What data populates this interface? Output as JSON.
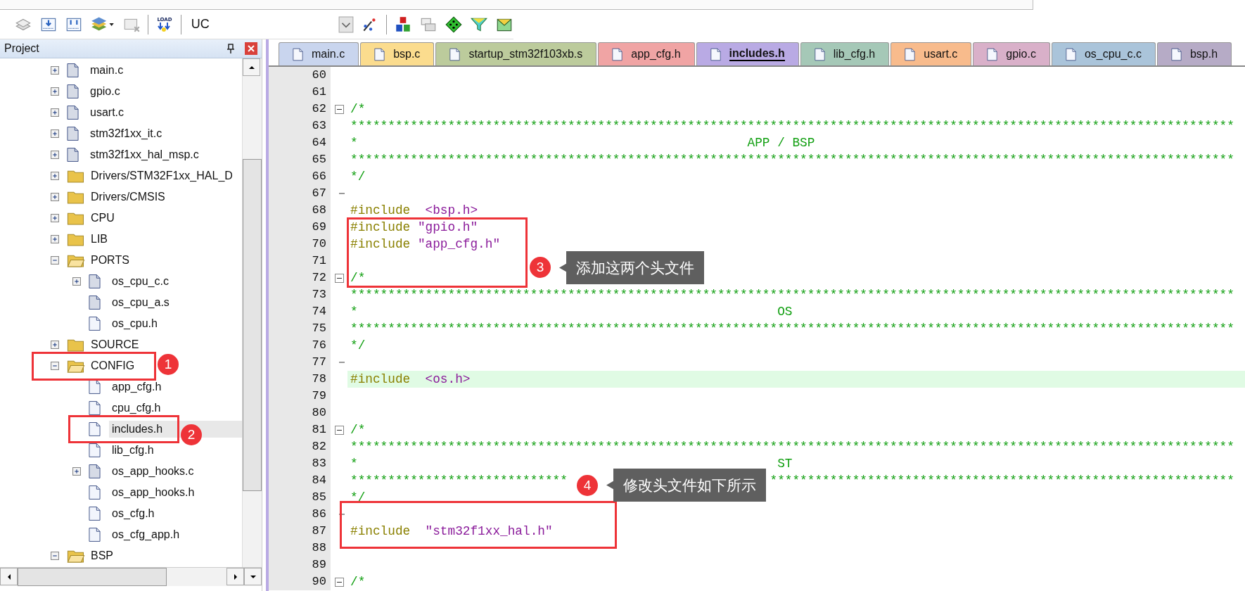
{
  "toolbar": {
    "load_label": "LOAD",
    "target": "UC"
  },
  "project": {
    "title": "Project",
    "tree": [
      {
        "children": [
          {
            "label": "main.c",
            "kind": "source",
            "expanded": false,
            "selected": false
          },
          {
            "label": "gpio.c",
            "kind": "source",
            "expanded": false,
            "selected": false
          },
          {
            "label": "usart.c",
            "kind": "source",
            "expanded": false,
            "selected": false
          },
          {
            "label": "stm32f1xx_it.c",
            "kind": "source",
            "expanded": false,
            "selected": false
          },
          {
            "label": "stm32f1xx_hal_msp.c",
            "kind": "source",
            "expanded": false,
            "selected": false
          }
        ]
      },
      {
        "label": "Drivers/STM32F1xx_HAL_D",
        "kind": "folder",
        "expanded": false,
        "selected": false
      },
      {
        "label": "Drivers/CMSIS",
        "kind": "folder",
        "expanded": false,
        "selected": false
      },
      {
        "label": "CPU",
        "kind": "folder",
        "expanded": false,
        "selected": false
      },
      {
        "label": "LIB",
        "kind": "folder",
        "expanded": false,
        "selected": false
      },
      {
        "label": "PORTS",
        "kind": "folder",
        "expanded": true,
        "selected": false,
        "children": [
          {
            "label": "os_cpu_c.c",
            "kind": "source",
            "expanded": false,
            "selected": false
          },
          {
            "label": "os_cpu_a.s",
            "kind": "source",
            "selected": false
          },
          {
            "label": "os_cpu.h",
            "kind": "header",
            "selected": false
          }
        ]
      },
      {
        "label": "SOURCE",
        "kind": "folder",
        "expanded": false,
        "selected": false
      },
      {
        "label": "CONFIG",
        "kind": "folder",
        "expanded": true,
        "selected": false,
        "children": [
          {
            "label": "app_cfg.h",
            "kind": "header",
            "selected": false
          },
          {
            "label": "cpu_cfg.h",
            "kind": "header",
            "selected": false
          },
          {
            "label": "includes.h",
            "kind": "header",
            "selected": true
          },
          {
            "label": "lib_cfg.h",
            "kind": "header",
            "selected": false
          },
          {
            "label": "os_app_hooks.c",
            "kind": "source",
            "expanded": false,
            "selected": false
          },
          {
            "label": "os_app_hooks.h",
            "kind": "header",
            "selected": false
          },
          {
            "label": "os_cfg.h",
            "kind": "header",
            "selected": false
          },
          {
            "label": "os_cfg_app.h",
            "kind": "header",
            "selected": false
          }
        ]
      },
      {
        "label": "BSP",
        "kind": "folder",
        "expanded": true,
        "selected": false
      }
    ]
  },
  "tabs": [
    {
      "label": "main.c",
      "color": "#c9d5ee",
      "selected": false
    },
    {
      "label": "bsp.c",
      "color": "#fbdc8e",
      "selected": false
    },
    {
      "label": "startup_stm32f103xb.s",
      "color": "#bccb9c",
      "selected": false
    },
    {
      "label": "app_cfg.h",
      "color": "#f0a4a4",
      "selected": false
    },
    {
      "label": "includes.h",
      "color": "#b9aae4",
      "selected": true
    },
    {
      "label": "lib_cfg.h",
      "color": "#a5c8b7",
      "selected": false
    },
    {
      "label": "usart.c",
      "color": "#f8bb8c",
      "selected": false
    },
    {
      "label": "gpio.c",
      "color": "#d9b0c9",
      "selected": false
    },
    {
      "label": "os_cpu_c.c",
      "color": "#aac4da",
      "selected": false
    },
    {
      "label": "bsp.h",
      "color": "#b6abc6",
      "selected": false
    }
  ],
  "code": [
    {
      "number": "60",
      "fold_start": false,
      "fold_end": false,
      "current": false
    },
    {
      "number": "61",
      "fold_start": false,
      "fold_end": false,
      "current": false
    },
    {
      "number": "62",
      "fold_start": true,
      "fold_end": false,
      "current": false,
      "kind": "comment",
      "text": "/*"
    },
    {
      "number": "63",
      "fold_start": false,
      "fold_end": false,
      "current": false,
      "kind": "comment",
      "text": "**********************************************************************************************************************"
    },
    {
      "number": "64",
      "fold_start": false,
      "fold_end": false,
      "current": false,
      "kind": "comment",
      "text": "*                                                    APP / BSP"
    },
    {
      "number": "65",
      "fold_start": false,
      "fold_end": false,
      "current": false,
      "kind": "comment",
      "text": "**********************************************************************************************************************"
    },
    {
      "number": "66",
      "fold_start": false,
      "fold_end": false,
      "current": false,
      "kind": "comment",
      "text": "*/"
    },
    {
      "number": "67",
      "fold_start": false,
      "fold_end": true,
      "current": false
    },
    {
      "number": "68",
      "fold_start": false,
      "fold_end": false,
      "current": false,
      "kind": "include",
      "text": "#include  <bsp.h>"
    },
    {
      "number": "69",
      "fold_start": false,
      "fold_end": false,
      "current": false,
      "kind": "include",
      "text": "#include \"gpio.h\""
    },
    {
      "number": "70",
      "fold_start": false,
      "fold_end": false,
      "current": false,
      "kind": "include",
      "text": "#include \"app_cfg.h\""
    },
    {
      "number": "71",
      "fold_start": false,
      "fold_end": false,
      "current": false
    },
    {
      "number": "72",
      "fold_start": true,
      "fold_end": false,
      "current": false,
      "kind": "comment",
      "text": "/*"
    },
    {
      "number": "73",
      "fold_start": false,
      "fold_end": false,
      "current": false,
      "kind": "comment",
      "text": "**********************************************************************************************************************"
    },
    {
      "number": "74",
      "fold_start": false,
      "fold_end": false,
      "current": false,
      "kind": "comment",
      "text": "*                                                        OS"
    },
    {
      "number": "75",
      "fold_start": false,
      "fold_end": false,
      "current": false,
      "kind": "comment",
      "text": "**********************************************************************************************************************"
    },
    {
      "number": "76",
      "fold_start": false,
      "fold_end": false,
      "current": false,
      "kind": "comment",
      "text": "*/"
    },
    {
      "number": "77",
      "fold_start": false,
      "fold_end": true,
      "current": false
    },
    {
      "number": "78",
      "fold_start": false,
      "fold_end": false,
      "current": true,
      "kind": "include",
      "text": "#include  <os.h>"
    },
    {
      "number": "79",
      "fold_start": false,
      "fold_end": false,
      "current": false
    },
    {
      "number": "80",
      "fold_start": false,
      "fold_end": false,
      "current": false
    },
    {
      "number": "81",
      "fold_start": true,
      "fold_end": false,
      "current": false,
      "kind": "comment",
      "text": "/*"
    },
    {
      "number": "82",
      "fold_start": false,
      "fold_end": false,
      "current": false,
      "kind": "comment",
      "text": "**********************************************************************************************************************"
    },
    {
      "number": "83",
      "fold_start": false,
      "fold_end": false,
      "current": false,
      "kind": "comment",
      "text": "*                                                        ST"
    },
    {
      "number": "84",
      "fold_start": false,
      "fold_end": false,
      "current": false,
      "kind": "comment",
      "segments": [
        "*****************************",
        "**************************************************************"
      ]
    },
    {
      "number": "85",
      "fold_start": false,
      "fold_end": false,
      "current": false,
      "kind": "comment",
      "text": "*/"
    },
    {
      "number": "86",
      "fold_start": false,
      "fold_end": true,
      "current": false
    },
    {
      "number": "87",
      "fold_start": false,
      "fold_end": false,
      "current": false,
      "kind": "include",
      "text": "#include  \"stm32f1xx_hal.h\""
    },
    {
      "number": "88",
      "fold_start": false,
      "fold_end": false,
      "current": false
    },
    {
      "number": "89",
      "fold_start": false,
      "fold_end": false,
      "current": false
    },
    {
      "number": "90",
      "fold_start": true,
      "fold_end": false,
      "current": false,
      "kind": "comment",
      "text": "/*"
    }
  ],
  "annotations": [
    {
      "number": "1"
    },
    {
      "number": "2"
    },
    {
      "number": "3",
      "note": "添加这两个头文件"
    },
    {
      "number": "4",
      "note": "修改头文件如下所示"
    }
  ]
}
